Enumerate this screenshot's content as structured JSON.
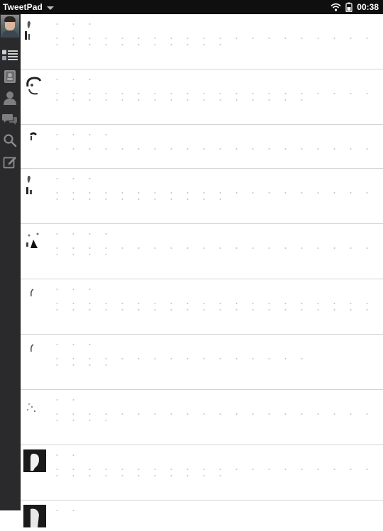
{
  "statusbar": {
    "app_title": "TweetPad",
    "time": "00:38",
    "icons": [
      "chevron-down-icon",
      "wifi-icon",
      "battery-icon"
    ]
  },
  "sidebar": {
    "items": [
      {
        "name": "avatar",
        "icon": "user-avatar"
      },
      {
        "name": "timeline",
        "icon": "list-icon"
      },
      {
        "name": "messages",
        "icon": "contact-card-icon"
      },
      {
        "name": "profile",
        "icon": "person-icon"
      },
      {
        "name": "direct-messages",
        "icon": "chat-bubbles-icon"
      },
      {
        "name": "search",
        "icon": "search-icon"
      },
      {
        "name": "compose",
        "icon": "compose-icon"
      }
    ]
  },
  "timeline": {
    "tweets": [
      {
        "author_tone": "#8f8f8f",
        "avatar_style": "silhouette"
      },
      {
        "author_tone": "#9c9c9c",
        "avatar_style": "dark-swirl"
      },
      {
        "author_tone": "#9c9c9c",
        "avatar_style": "dark-line"
      },
      {
        "author_tone": "#8f8f8f",
        "avatar_style": "silhouette"
      },
      {
        "author_tone": "#9c9c9c",
        "avatar_style": "dark-speckle"
      },
      {
        "author_tone": "#a5a5a5",
        "avatar_style": "thin-line"
      },
      {
        "author_tone": "#a5a5a5",
        "avatar_style": "thin-line"
      },
      {
        "author_tone": "#9c9c9c",
        "avatar_style": "light-speckle"
      },
      {
        "author_tone": "#8f8f8f",
        "avatar_style": "dark-block"
      },
      {
        "author_tone": "#8f8f8f",
        "avatar_style": "dark-block"
      }
    ]
  },
  "colors": {
    "statusbar_bg": "#0f0f0f",
    "sidebar_bg": "#2a2a2c",
    "timeline_bg": "#ffffff",
    "divider": "#d4d4d4"
  }
}
